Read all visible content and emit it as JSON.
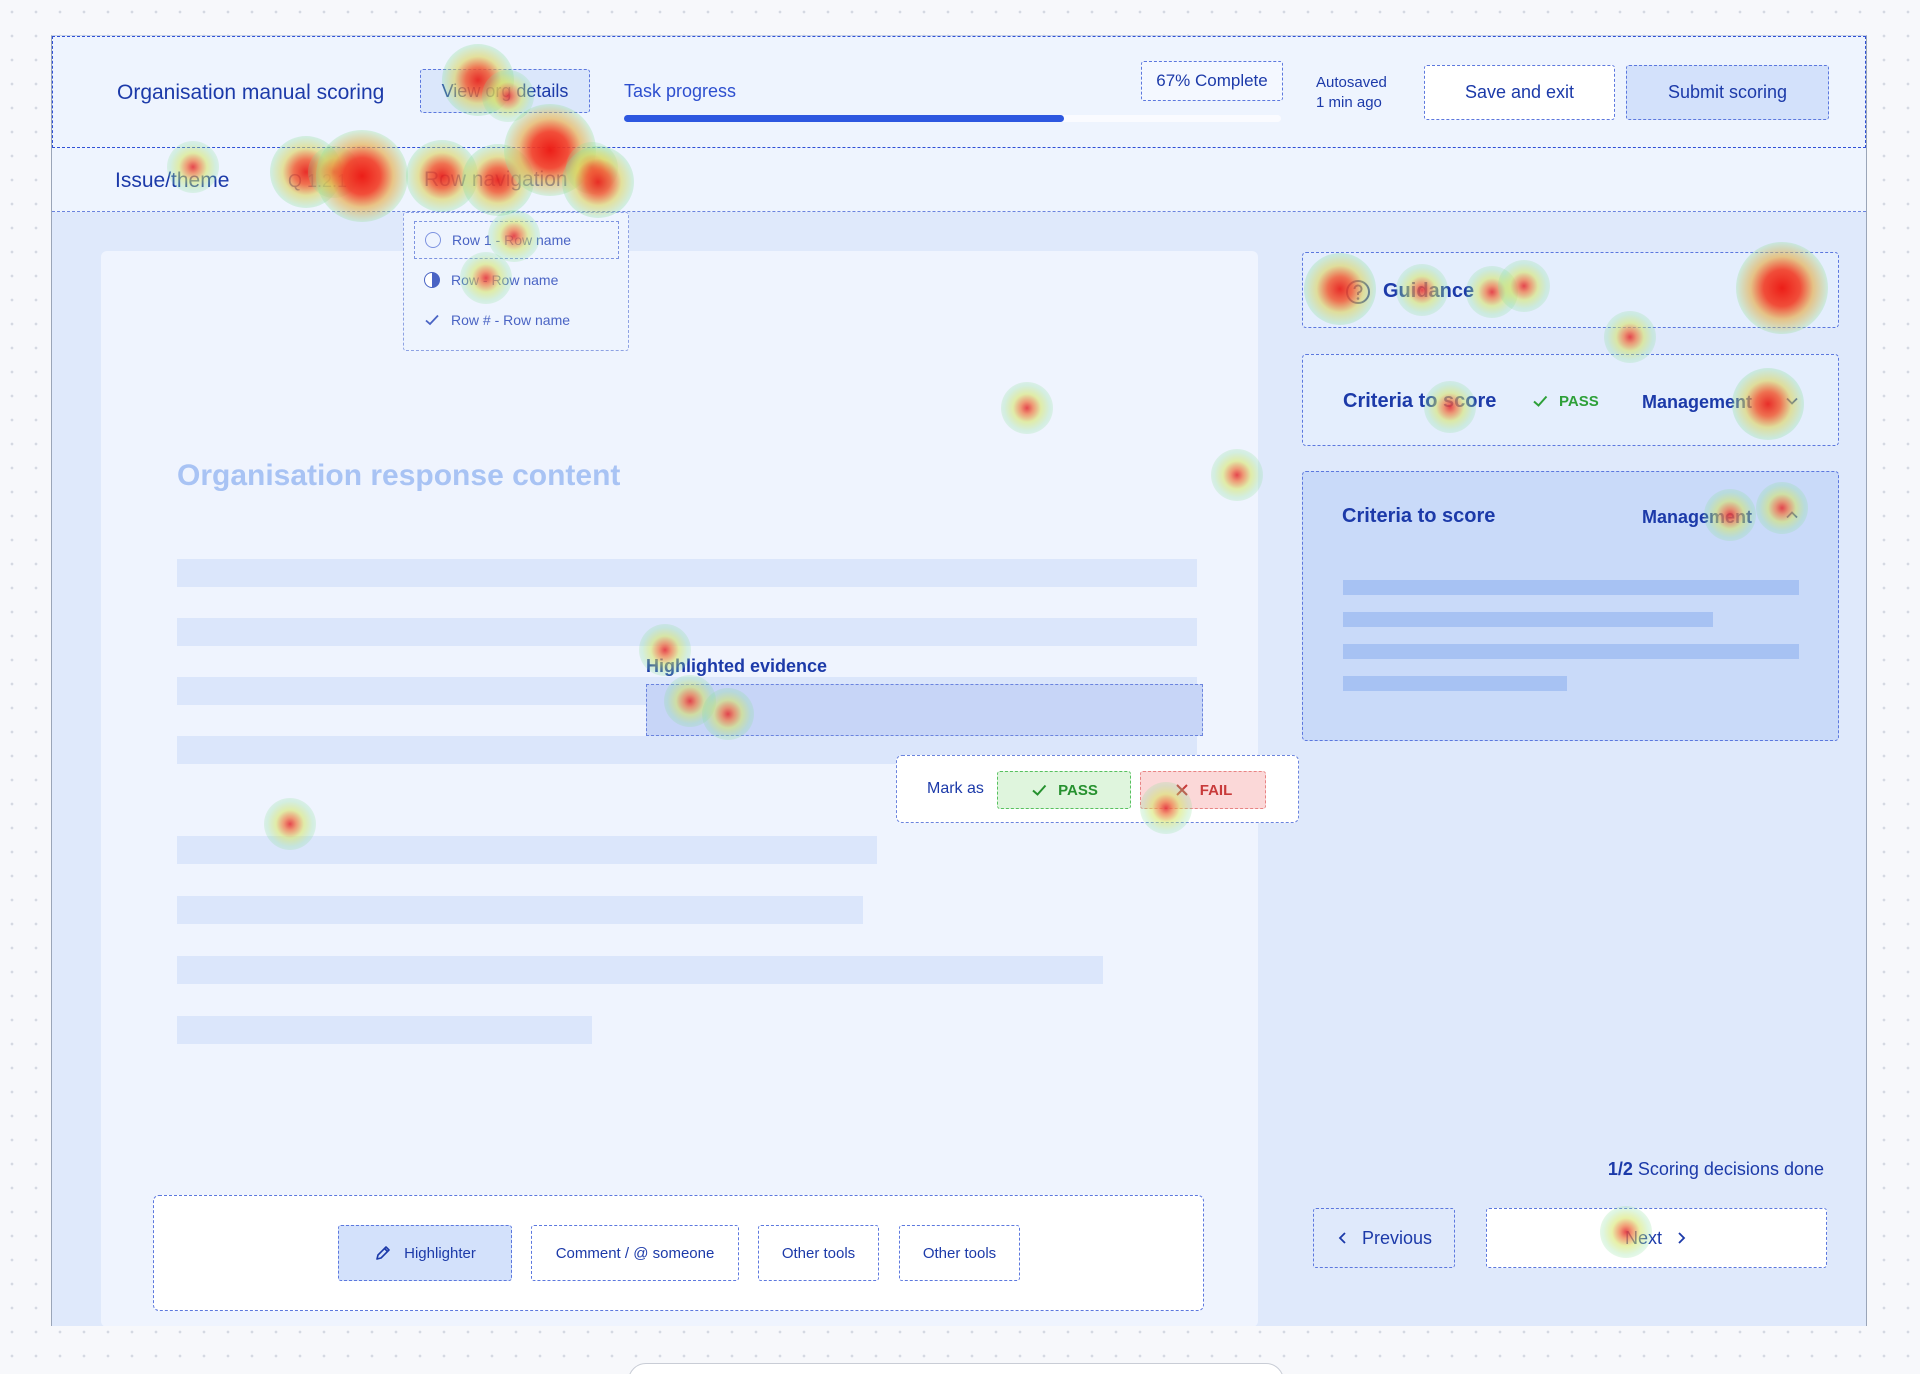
{
  "header": {
    "app_title": "Organisation manual scoring",
    "view_org_details": "View org details",
    "task_progress_label": "Task progress",
    "progress_fraction": 0.67,
    "complete_badge": "67% Complete",
    "autosaved_line1": "Autosaved",
    "autosaved_line2": "1 min ago",
    "save_exit": "Save and exit",
    "submit": "Submit scoring"
  },
  "subheader": {
    "issue_label": "Issue/theme",
    "issue_code": "Q 1.2.1",
    "row_navigation": "Row navigation"
  },
  "row_dropdown": {
    "items": [
      {
        "label": "Row 1 - Row name",
        "state": "empty-circle"
      },
      {
        "label": "Row - Row name",
        "state": "half-circle"
      },
      {
        "label": "Row # - Row name",
        "state": "check"
      }
    ]
  },
  "content": {
    "title": "Organisation response content",
    "highlight_label": "Highlighted evidence",
    "mark_as": "Mark as",
    "pass": "PASS",
    "fail": "FAIL"
  },
  "tools": {
    "highlighter": "Highlighter",
    "comment": "Comment / @ someone",
    "other1": "Other tools",
    "other2": "Other tools"
  },
  "sidebar": {
    "guidance": "Guidance",
    "criteria_collapsed": {
      "title": "Criteria to score",
      "status": "PASS",
      "category": "Management"
    },
    "criteria_expanded": {
      "title": "Criteria to score",
      "category": "Management"
    },
    "decisions_count": "1/2",
    "decisions_text": "Scoring decisions done",
    "previous": "Previous",
    "next": "Next"
  },
  "colors": {
    "accent": "#2d57e0",
    "text_primary": "#1c3aa9",
    "pass_green": "#26912f",
    "fail_red": "#c83a3a",
    "heat_hot": "#e4343a"
  },
  "icons": [
    "pencil-icon",
    "question-circle-icon",
    "check-icon",
    "cross-icon",
    "chevron-down-icon",
    "chevron-up-icon",
    "chevron-left-icon",
    "chevron-right-icon"
  ]
}
